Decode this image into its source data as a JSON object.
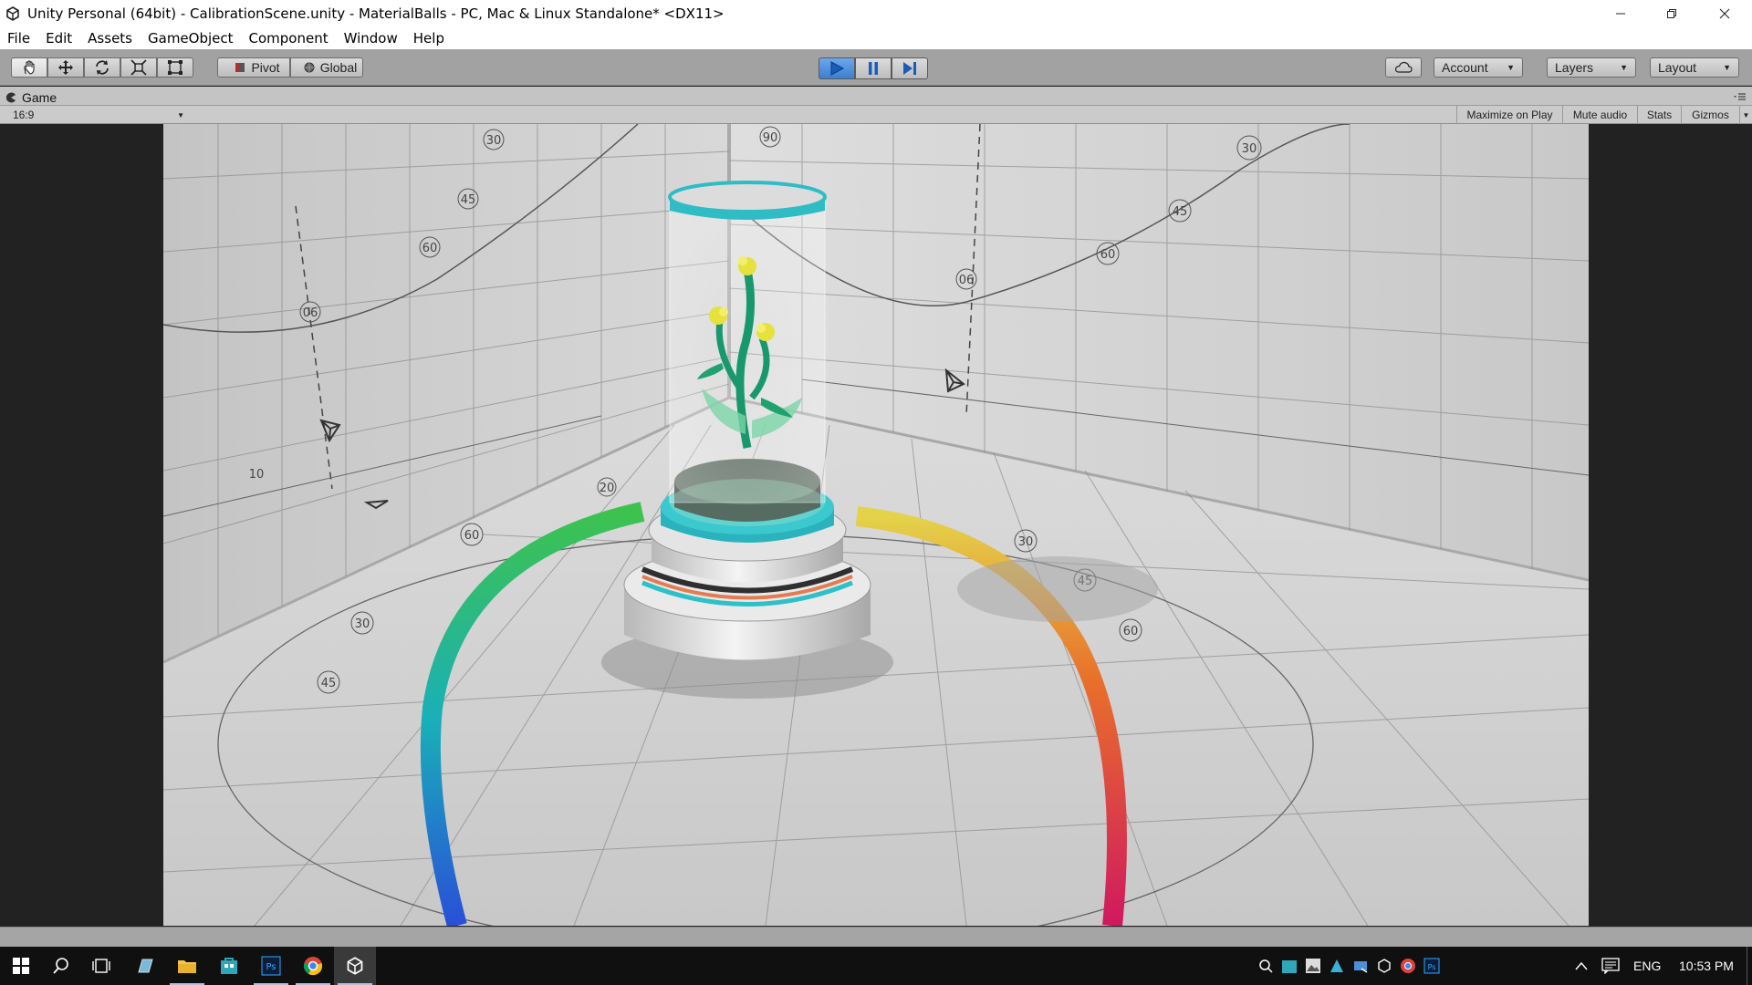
{
  "window": {
    "title": "Unity Personal (64bit) - CalibrationScene.unity - MaterialBalls - PC, Mac & Linux Standalone* <DX11>"
  },
  "menu": [
    "File",
    "Edit",
    "Assets",
    "GameObject",
    "Component",
    "Window",
    "Help"
  ],
  "toolbar": {
    "pivot_label": "Pivot",
    "global_label": "Global",
    "account_label": "Account",
    "layers_label": "Layers",
    "layout_label": "Layout"
  },
  "game_view": {
    "tab_label": "Game",
    "aspect": "16:9",
    "maximize_on_play": "Maximize on Play",
    "mute_audio": "Mute audio",
    "stats": "Stats",
    "gizmos": "Gizmos"
  },
  "scene_labels": {
    "left_wall": [
      "06",
      "60",
      "45",
      "30"
    ],
    "right_wall": [
      "90",
      "06",
      "60",
      "45",
      "30"
    ],
    "floor": [
      "30",
      "45",
      "60",
      "30",
      "45",
      "60",
      "20"
    ],
    "left_tick": "10"
  },
  "taskbar": {
    "language": "ENG",
    "time": "10:53 PM"
  },
  "colors": {
    "play_active": "#3d8ee6",
    "teal_accent": "#2ec0c8",
    "toolbar_bg": "#a2a2a2",
    "taskbar_bg": "#101010"
  }
}
